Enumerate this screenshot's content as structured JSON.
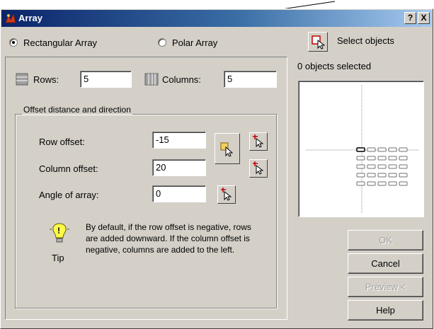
{
  "window": {
    "title": "Array",
    "help_btn": "?",
    "close_btn": "X"
  },
  "mode": {
    "rectangular_label": "Rectangular Array",
    "polar_label": "Polar Array",
    "selected": "rectangular"
  },
  "select": {
    "button_label": "Select objects",
    "status": "0 objects selected"
  },
  "grid": {
    "rows_label": "Rows:",
    "rows_value": "5",
    "columns_label": "Columns:",
    "columns_value": "5"
  },
  "offset": {
    "group_label": "Offset distance and direction",
    "row_label": "Row offset:",
    "row_value": "-15",
    "column_label": "Column offset:",
    "column_value": "20",
    "angle_label": "Angle of array:",
    "angle_value": "0"
  },
  "tip": {
    "label": "Tip",
    "text": "By default, if the row offset is negative, rows are added downward.  If the column offset is negative, columns are added to the left."
  },
  "buttons": {
    "ok": "OK",
    "cancel": "Cancel",
    "preview": "Preview <",
    "help": "Help"
  },
  "colors": {
    "dialog_bg": "#d4d0c8",
    "title_start": "#0a246a",
    "title_end": "#a6caf0",
    "disabled_text": "#a0a0a0"
  },
  "icons": [
    "array-app-icon",
    "help-icon",
    "close-icon",
    "select-objects-icon",
    "rows-icon",
    "columns-icon",
    "pick-both-offsets-icon",
    "pick-row-offset-icon",
    "pick-column-offset-icon",
    "pick-angle-icon",
    "tip-lightbulb-icon"
  ]
}
